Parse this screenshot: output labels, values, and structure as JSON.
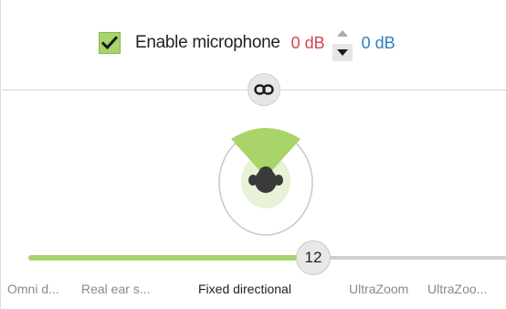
{
  "microphone": {
    "enabled": true,
    "label": "Enable microphone",
    "left_db": "0 dB",
    "right_db": "0 dB"
  },
  "slider": {
    "value": "12",
    "modes": [
      {
        "label": "Omni d...",
        "active": false
      },
      {
        "label": "Real ear s...",
        "active": false
      },
      {
        "label": "Fixed directional",
        "active": true
      },
      {
        "label": "UltraZoom",
        "active": false
      },
      {
        "label": "UltraZoo...",
        "active": false
      }
    ]
  },
  "colors": {
    "accent_green": "#a8d46a",
    "db_left": "#d9434f",
    "db_right": "#2f7fc1"
  },
  "icons": {
    "checkbox": "check-icon",
    "step_up": "triangle-up-icon",
    "step_down": "triangle-down-icon",
    "link": "link-icon",
    "pattern": "directional-pattern-icon"
  }
}
